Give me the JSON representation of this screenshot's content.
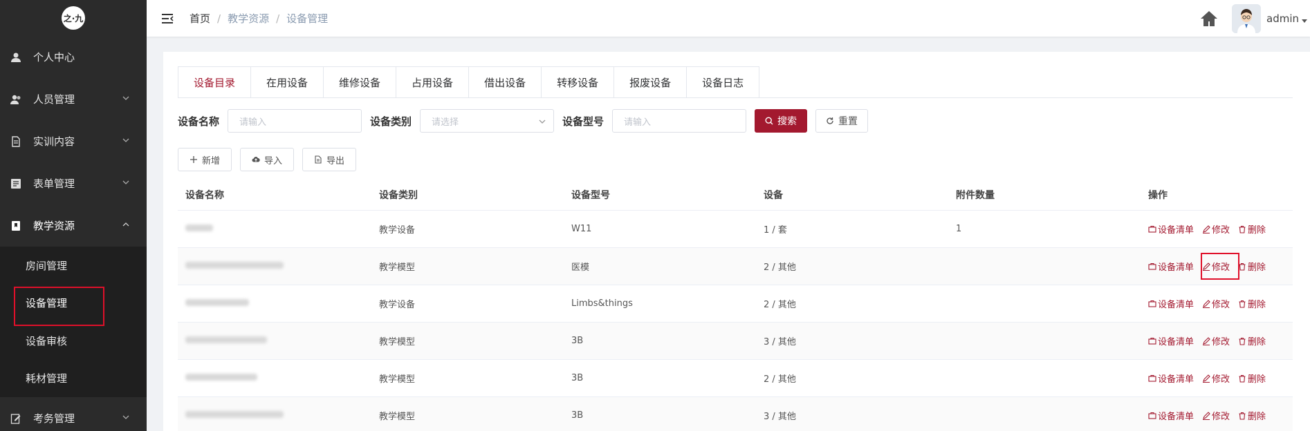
{
  "sidebar": {
    "logo_text": "之·九",
    "menu": [
      {
        "label": "个人中心"
      },
      {
        "label": "人员管理"
      },
      {
        "label": "实训内容"
      },
      {
        "label": "表单管理"
      },
      {
        "label": "教学资源"
      }
    ],
    "sub_items": [
      {
        "label": "房间管理"
      },
      {
        "label": "设备管理"
      },
      {
        "label": "设备审核"
      },
      {
        "label": "耗材管理"
      }
    ],
    "last_menu": {
      "label": "考务管理"
    }
  },
  "header": {
    "breadcrumb": [
      "首页",
      "教学资源",
      "设备管理"
    ],
    "separator": "/",
    "user": "admin"
  },
  "tabs": [
    "设备目录",
    "在用设备",
    "维修设备",
    "占用设备",
    "借出设备",
    "转移设备",
    "报废设备",
    "设备日志"
  ],
  "filters": {
    "name_label": "设备名称",
    "name_placeholder": "请输入",
    "category_label": "设备类别",
    "category_placeholder": "请选择",
    "model_label": "设备型号",
    "model_placeholder": "请输入",
    "search_label": "搜索",
    "reset_label": "重置"
  },
  "actions": {
    "add_label": "新增",
    "import_label": "导入",
    "export_label": "导出"
  },
  "table": {
    "columns": [
      "设备名称",
      "设备类别",
      "设备型号",
      "设备",
      "附件数量",
      "操作"
    ],
    "rows": [
      {
        "category": "教学设备",
        "model": "W11",
        "unit": "1 / 套",
        "attachments": "1"
      },
      {
        "category": "教学模型",
        "model": "医模",
        "unit": "2 / 其他",
        "attachments": ""
      },
      {
        "category": "教学设备",
        "model": "Limbs&things",
        "unit": "2 / 其他",
        "attachments": ""
      },
      {
        "category": "教学模型",
        "model": "3B",
        "unit": "3 / 其他",
        "attachments": ""
      },
      {
        "category": "教学模型",
        "model": "3B",
        "unit": "2 / 其他",
        "attachments": ""
      },
      {
        "category": "教学模型",
        "model": "3B",
        "unit": "3 / 其他",
        "attachments": ""
      }
    ],
    "op_list": "设备清单",
    "op_edit": "修改",
    "op_delete": "删除"
  },
  "colors": {
    "primary": "#a3192f",
    "sidebar_bg": "#2b2b2b",
    "highlight_box": "#e0102a"
  }
}
